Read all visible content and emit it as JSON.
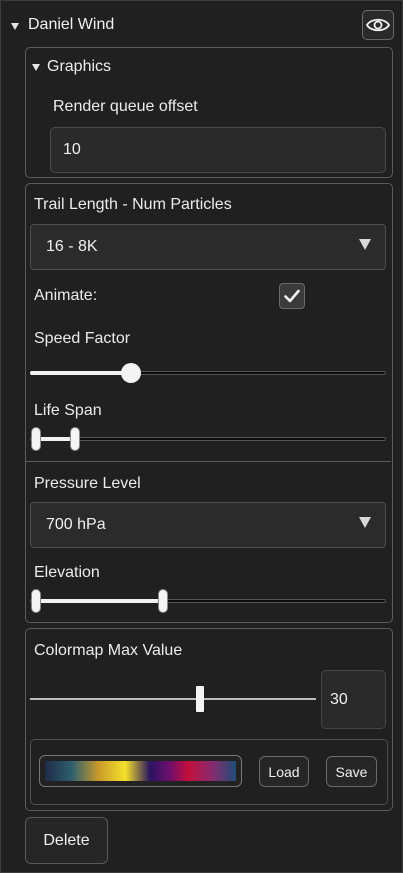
{
  "layer": {
    "name": "Daniel Wind",
    "visibility_icon": "eye-icon",
    "expanded": true
  },
  "graphics": {
    "title": "Graphics",
    "render_queue_offset_label": "Render queue offset",
    "render_queue_offset_value": "10"
  },
  "particles": {
    "trail_length_label": "Trail Length - Num Particles",
    "trail_length_value": "16 - 8K",
    "animate_label": "Animate:",
    "animate_checked": true,
    "speed_factor_label": "Speed Factor",
    "speed_factor_fraction": 0.3,
    "life_span_label": "Life Span",
    "life_span_range_fraction": [
      0.0,
      0.12
    ]
  },
  "pressure": {
    "label": "Pressure Level",
    "value": "700 hPa",
    "elevation_label": "Elevation",
    "elevation_range_fraction": [
      0.0,
      0.36
    ]
  },
  "colormap": {
    "max_label": "Colormap Max Value",
    "max_slider_fraction": 0.6,
    "max_value": "30",
    "load_label": "Load",
    "save_label": "Save"
  },
  "actions": {
    "delete_label": "Delete"
  },
  "colors": {
    "background": "#202020",
    "border": "#5b5b5b",
    "text": "#ececec",
    "slider_fill": "#f2f2f2"
  }
}
